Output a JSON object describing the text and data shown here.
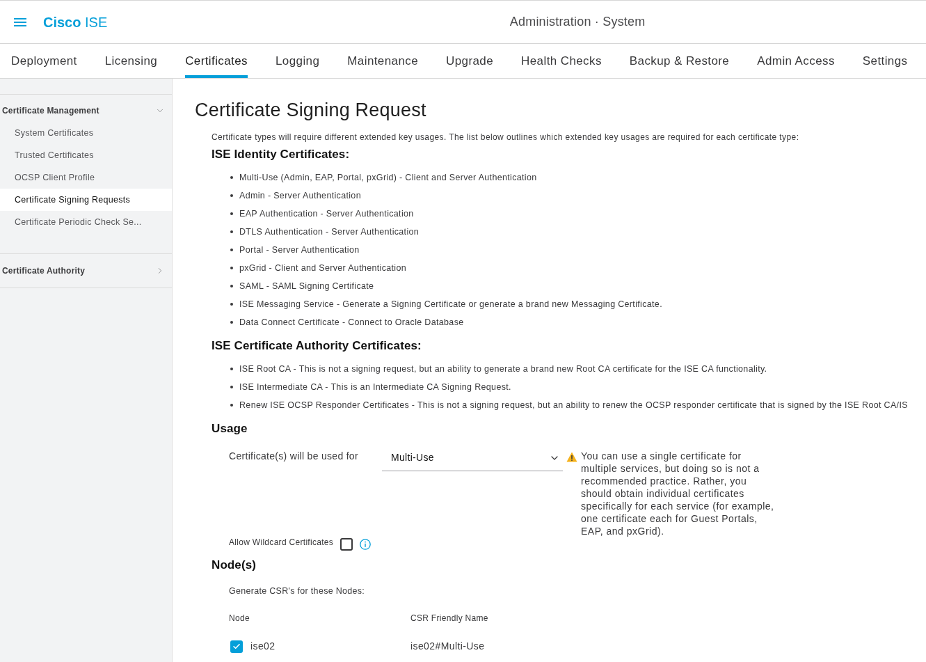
{
  "header": {
    "brand": "**Cisco** ISE",
    "title": "Administration · System"
  },
  "tabs": [
    {
      "label": "Deployment",
      "selected": false
    },
    {
      "label": "Licensing",
      "selected": false
    },
    {
      "label": "Certificates",
      "selected": true
    },
    {
      "label": "Logging",
      "selected": false
    },
    {
      "label": "Maintenance",
      "selected": false
    },
    {
      "label": "Upgrade",
      "selected": false
    },
    {
      "label": "Health Checks",
      "selected": false
    },
    {
      "label": "Backup & Restore",
      "selected": false
    },
    {
      "label": "Admin Access",
      "selected": false
    },
    {
      "label": "Settings",
      "selected": false
    }
  ],
  "sidebar": {
    "groups": [
      {
        "title": "Certificate Management",
        "expanded": true,
        "items": [
          {
            "label": "System Certificates",
            "selected": false
          },
          {
            "label": "Trusted Certificates",
            "selected": false
          },
          {
            "label": "OCSP Client Profile",
            "selected": false
          },
          {
            "label": "Certificate Signing Requests",
            "selected": true
          },
          {
            "label": "Certificate Periodic Check Se...",
            "selected": false
          }
        ]
      },
      {
        "title": "Certificate Authority",
        "expanded": false
      }
    ]
  },
  "content": {
    "title": "Certificate Signing Request",
    "intro": "Certificate types will require different extended key usages. The list below outlines which extended key usages are required for each certificate type:",
    "sections": [
      {
        "heading": "ISE Identity Certificates:",
        "items": [
          "Multi-Use (Admin, EAP, Portal, pxGrid) - Client and Server Authentication",
          "Admin - Server Authentication",
          "EAP Authentication - Server Authentication",
          "DTLS Authentication - Server Authentication",
          "Portal - Server Authentication",
          "pxGrid - Client and Server Authentication",
          "SAML - SAML Signing Certificate",
          "ISE Messaging Service - Generate a Signing Certificate or generate a brand new Messaging Certificate.",
          "Data Connect Certificate - Connect to Oracle Database"
        ]
      },
      {
        "heading": "ISE Certificate Authority Certificates:",
        "items": [
          "ISE Root CA - This is not a signing request, but an ability to generate a brand new Root CA certificate for the ISE CA functionality.",
          "ISE Intermediate CA - This is an Intermediate CA Signing Request.",
          "Renew ISE OCSP Responder Certificates - This is not a signing request, but an ability to renew the OCSP responder certificate that is signed by the ISE Root CA/IS"
        ]
      }
    ],
    "usage": {
      "heading": "Usage",
      "label": "Certificate(s) will be used for",
      "value": "Multi-Use",
      "warning_lines": [
        "You can use a single certificate for",
        "multiple services, but doing so is not a",
        "recommended practice. Rather, you",
        "should obtain individual certificates",
        "specifically for each service (for example,",
        "one certificate each for Guest Portals,",
        "EAP, and pxGrid)."
      ],
      "wildcard": {
        "label": "Allow Wildcard Certificates",
        "checked": false
      }
    },
    "nodes": {
      "heading": "Node(s)",
      "caption": "Generate CSR's for these Nodes:",
      "columns": [
        "Node",
        "CSR Friendly Name"
      ],
      "rows": [
        {
          "node": "ise02",
          "checked": true,
          "friendly_name": "ise02#Multi-Use"
        }
      ]
    }
  }
}
